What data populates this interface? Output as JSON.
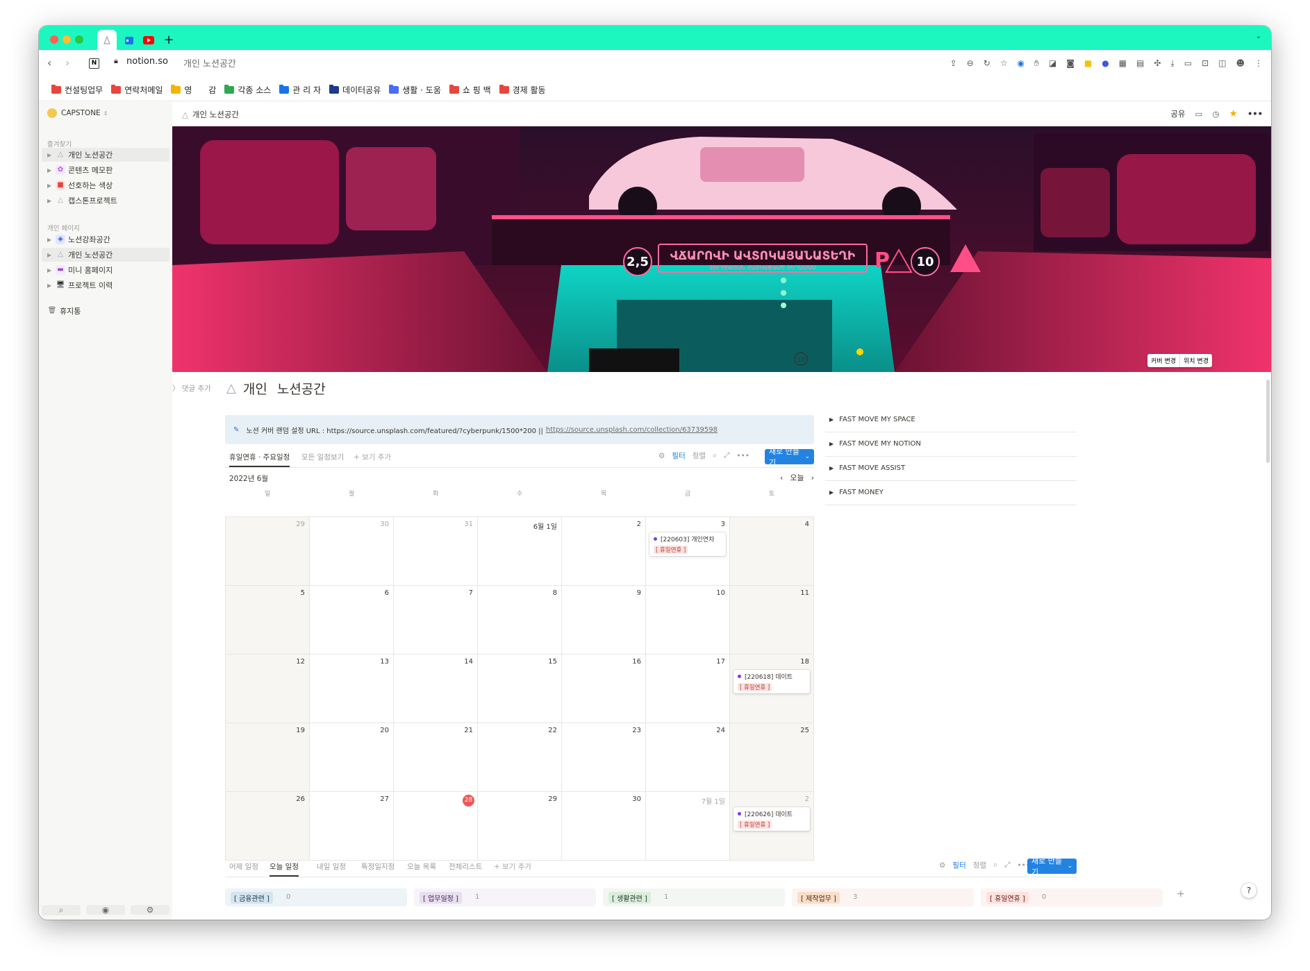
{
  "browser": {
    "url_domain": "notion.so",
    "url_path": "개인 노션공간",
    "bookmarks": [
      {
        "label": "컨설팅업무",
        "color": "#e8453c"
      },
      {
        "label": "연락처메일",
        "color": "#e8453c"
      },
      {
        "label": "영 감",
        "color": "#f4b400"
      },
      {
        "label": "각종 소스",
        "color": "#2fa84f"
      },
      {
        "label": "관 리 자",
        "color": "#1a73e8"
      },
      {
        "label": "데이터공유",
        "color": "#1e3a8a"
      },
      {
        "label": "생활 · 도움",
        "color": "#4a6cf7"
      },
      {
        "label": "쇼 핑 백",
        "color": "#e8453c"
      },
      {
        "label": "경제 활동",
        "color": "#e8453c"
      }
    ]
  },
  "sidebar": {
    "workspace": "CAPSTONE",
    "favorites_header": "즐겨찾기",
    "favorites": [
      {
        "label": "개인 노션공간"
      },
      {
        "label": "콘텐츠 메모판"
      },
      {
        "label": "선호하는 색상"
      },
      {
        "label": "캡스톤프로젝트"
      }
    ],
    "private_header": "개인 페이지",
    "private": [
      {
        "label": "노션강좌공간"
      },
      {
        "label": "개인 노션공간"
      },
      {
        "label": "미니 홈페이지"
      },
      {
        "label": "프로젝트 이력"
      }
    ],
    "trash": "휴지통"
  },
  "topbar": {
    "breadcrumb": "개인 노션공간",
    "share": "공유"
  },
  "cover": {
    "change_cover": "커버 변경",
    "reposition": "위치 변경",
    "sign_main": "ՎՃԱՐՈՎԻ ԱՎՏՈԿԱՅԱՆԱՏԵՂԻ",
    "sign_sub": "ՏԵՐՈՒԹՅԱՆ ՀԱՏԿԱՑՎԱԾ ՏԵՂԱՄԱՍ",
    "sign_left": "2,5",
    "sign_right": "10",
    "sign_bottom": "10"
  },
  "page": {
    "add_comment": "댓글 추가",
    "title": "개인 노션공간",
    "callout_text": "노션 커버 랜덤 설정 URL : https://source.unsplash.com/featured/?cyberpunk/1500*200 ||",
    "callout_link": "https://source.unsplash.com/collection/63739598"
  },
  "calendar": {
    "tabs": [
      "휴일연휴 · 주요일정",
      "모든 일정보기"
    ],
    "add_view": "+ 보기 추가",
    "filter": "필터",
    "sort": "정렬",
    "new_button": "새로 만들기",
    "month": "2022년 6월",
    "today": "오늘",
    "weekdays": [
      "일",
      "월",
      "화",
      "수",
      "목",
      "금",
      "토"
    ],
    "days": [
      "29",
      "30",
      "31",
      "6월 1일",
      "2",
      "3",
      "4",
      "5",
      "6",
      "7",
      "8",
      "9",
      "10",
      "11",
      "12",
      "13",
      "14",
      "15",
      "16",
      "17",
      "18",
      "19",
      "20",
      "21",
      "22",
      "23",
      "24",
      "25",
      "26",
      "27",
      "28",
      "29",
      "30",
      "7월 1일",
      "2"
    ],
    "events": [
      {
        "title": "[220603] 개인연차",
        "tag": "[ 휴일연휴 ]"
      },
      {
        "title": "[220618] 데이트",
        "tag": "[ 휴일연휴 ]"
      },
      {
        "title": "[220626] 데이트",
        "tag": "[ 휴일연휴 ]"
      }
    ]
  },
  "toggles": [
    "FAST MOVE MY SPACE",
    "FAST MOVE MY NOTION",
    "FAST MOVE ASSIST",
    "FAST MONEY"
  ],
  "board": {
    "tabs": [
      "어제 일정",
      "오늘 일정",
      "내일 일정",
      "특정일지정",
      "오늘 목록",
      "전체리스트"
    ],
    "add_view": "+ 보기 추가",
    "filter": "필터",
    "sort": "정렬",
    "new_button": "새로 만들기",
    "columns": [
      {
        "tag": "[ 금융관련 ]",
        "count": "0",
        "bg": "#eef3f8",
        "tagbg": "#d3e5ef",
        "tagcolor": "#183347"
      },
      {
        "tag": "[ 업무일정 ]",
        "count": "1",
        "bg": "#f6f3f9",
        "tagbg": "#e8deee",
        "tagcolor": "#412454"
      },
      {
        "tag": "[ 생활관련 ]",
        "count": "1",
        "bg": "#f3f6f3",
        "tagbg": "#dbeddb",
        "tagcolor": "#1c3829"
      },
      {
        "tag": "[ 제작업무 ]",
        "count": "3",
        "bg": "#fbf4f1",
        "tagbg": "#fadec9",
        "tagcolor": "#49290e"
      },
      {
        "tag": "[ 휴일연휴 ]",
        "count": "0",
        "bg": "#fcf4f3",
        "tagbg": "#ffe2dd",
        "tagcolor": "#5d1715"
      }
    ]
  },
  "help": "?"
}
